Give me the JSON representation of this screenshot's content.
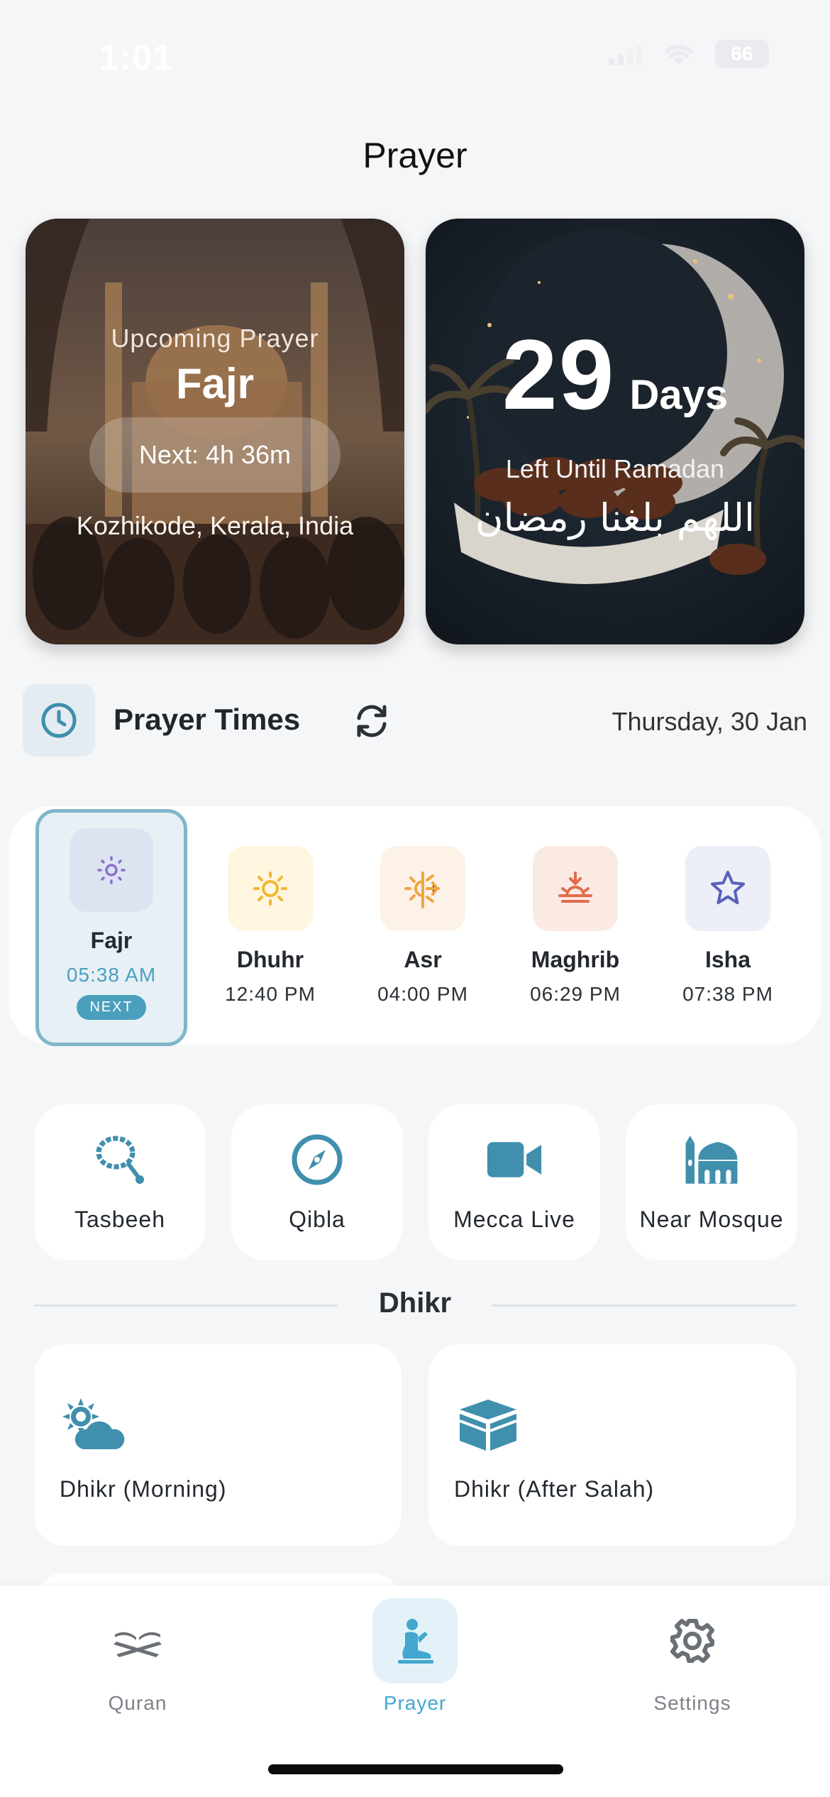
{
  "status_bar": {
    "time": "1:01",
    "battery": "66"
  },
  "header": {
    "title": "Prayer"
  },
  "upcoming": {
    "label": "Upcoming Prayer",
    "name": "Fajr",
    "next": "Next: 4h 36m",
    "location": "Kozhikode, Kerala, India"
  },
  "ramadan": {
    "days": "29",
    "days_word": "Days",
    "subtitle": "Left Until Ramadan",
    "arabic": "اللهم بلغنا رمضان"
  },
  "prayer_times": {
    "title": "Prayer Times",
    "date": "Thursday, 30 Jan",
    "items": [
      {
        "name": "Fajr",
        "time": "05:38 AM",
        "badge": "NEXT",
        "icon": "sun-dim-icon",
        "active": true
      },
      {
        "name": "Dhuhr",
        "time": "12:40 PM",
        "icon": "sun-icon"
      },
      {
        "name": "Asr",
        "time": "04:00 PM",
        "icon": "sun-snow-icon"
      },
      {
        "name": "Maghrib",
        "time": "06:29 PM",
        "icon": "sunset-icon"
      },
      {
        "name": "Isha",
        "time": "07:38 PM",
        "icon": "star-icon"
      }
    ]
  },
  "actions": [
    {
      "label": "Tasbeeh",
      "icon": "prayer-beads-icon"
    },
    {
      "label": "Qibla",
      "icon": "compass-icon"
    },
    {
      "label": "Mecca Live",
      "icon": "video-camera-icon"
    },
    {
      "label": "Near Mosque",
      "icon": "mosque-icon"
    }
  ],
  "dhikr": {
    "section_title": "Dhikr",
    "cards": [
      {
        "label": "Dhikr (Morning)",
        "icon": "sun-cloud-icon"
      },
      {
        "label": "Dhikr (After Salah)",
        "icon": "kaaba-icon"
      }
    ]
  },
  "tabs": [
    {
      "label": "Quran",
      "icon": "quran-stand-icon"
    },
    {
      "label": "Prayer",
      "icon": "praying-person-icon",
      "active": true
    },
    {
      "label": "Settings",
      "icon": "gear-icon"
    }
  ],
  "colors": {
    "accent": "#43a7cf",
    "icon_teal": "#3f8fad",
    "background": "#f5f6f8"
  }
}
